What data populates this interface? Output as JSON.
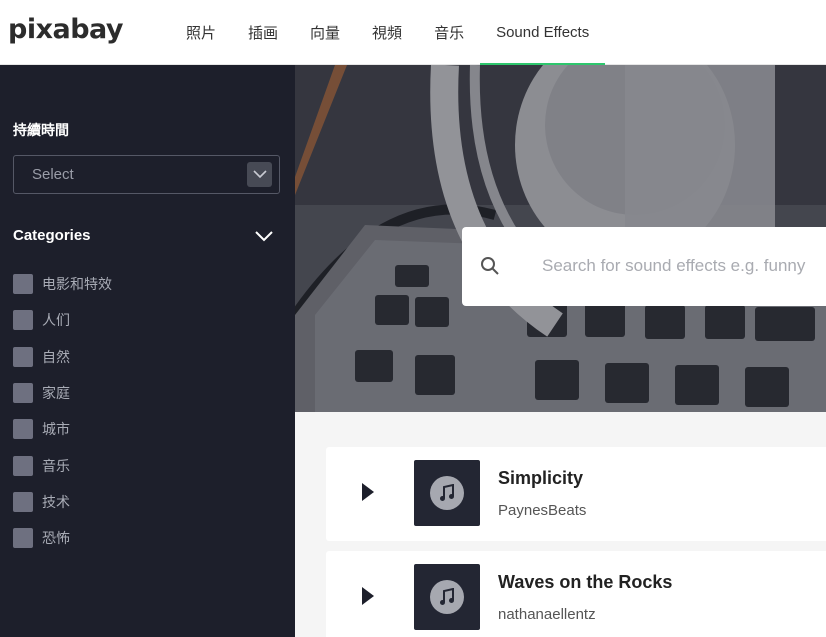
{
  "header": {
    "logo": "pixabay",
    "nav": [
      "照片",
      "插画",
      "向量",
      "視頻",
      "音乐",
      "Sound Effects"
    ],
    "active_nav": "Sound Effects"
  },
  "sidebar": {
    "duration_label": "持續時間",
    "select_placeholder": "Select",
    "categories_title": "Categories",
    "categories": [
      "电影和特效",
      "人们",
      "自然",
      "家庭",
      "城市",
      "音乐",
      "技术",
      "恐怖"
    ]
  },
  "search": {
    "placeholder": "Search for sound effects e.g. funny"
  },
  "tracks": [
    {
      "title": "Simplicity",
      "artist": "PaynesBeats"
    },
    {
      "title": "Waves on the Rocks",
      "artist": "nathanaellentz"
    }
  ],
  "colors": {
    "accent": "#2ec66d",
    "sidebar_bg": "#1d1f2b",
    "content_bg": "#f5f5f5"
  }
}
